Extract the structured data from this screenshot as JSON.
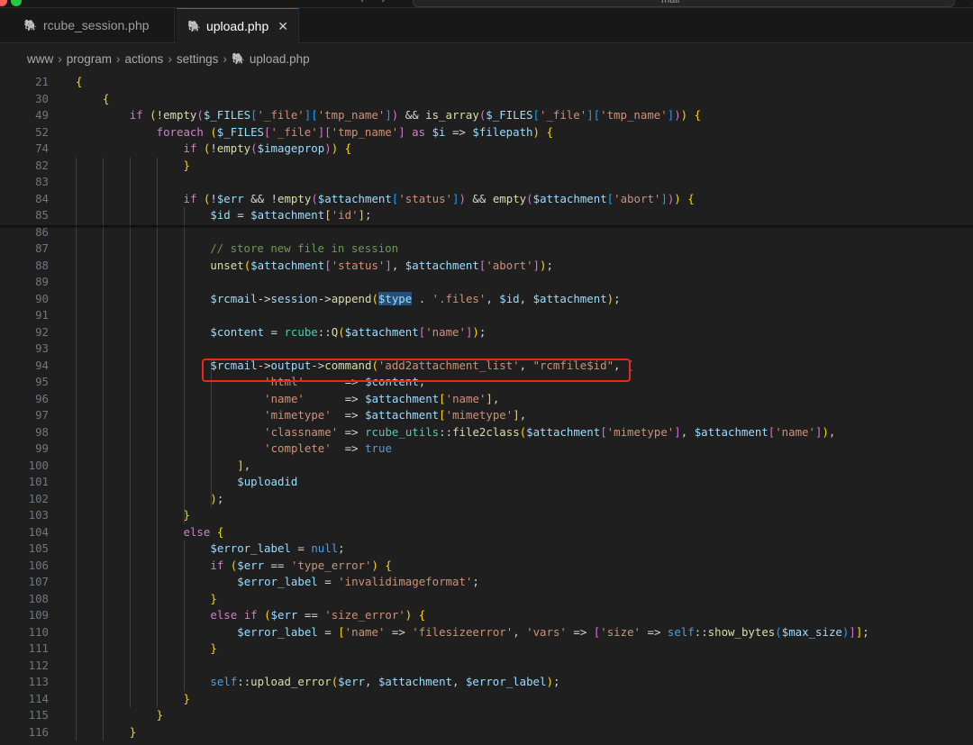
{
  "titlebar": {
    "nav": "‹ ›",
    "search_text": "mail"
  },
  "tabs": [
    {
      "label": "rcube_session.php",
      "active": false
    },
    {
      "label": "upload.php",
      "active": true
    }
  ],
  "breadcrumb": [
    "www",
    "program",
    "actions",
    "settings",
    "upload.php"
  ],
  "colors": {
    "keyword": "#c586c0",
    "function": "#dcdcaa",
    "variable": "#9cdcfe",
    "string": "#ce9178",
    "comment": "#6a9955",
    "highlight_box": "#e8281b"
  },
  "code_lines": [
    {
      "n": "21",
      "code": "{"
    },
    {
      "n": "30",
      "code": "    {"
    },
    {
      "n": "49",
      "code": "        if (!empty($_FILES['_file']['tmp_name']) && is_array($_FILES['_file']['tmp_name'])) {"
    },
    {
      "n": "52",
      "code": "            foreach ($_FILES['_file']['tmp_name'] as $i => $filepath) {"
    },
    {
      "n": "74",
      "code": "                if (!empty($imageprop)) {"
    },
    {
      "n": "82",
      "code": "                }"
    },
    {
      "n": "83",
      "code": ""
    },
    {
      "n": "84",
      "code": "                if (!$err && !empty($attachment['status']) && empty($attachment['abort'])) {"
    },
    {
      "n": "85",
      "code": "                    $id = $attachment['id'];"
    },
    {
      "n": "86",
      "code": ""
    },
    {
      "n": "87",
      "code": "                    // store new file in session"
    },
    {
      "n": "88",
      "code": "                    unset($attachment['status'], $attachment['abort']);"
    },
    {
      "n": "89",
      "code": ""
    },
    {
      "n": "90",
      "code": "                    $rcmail->session->append($type . '.files', $id, $attachment);"
    },
    {
      "n": "91",
      "code": ""
    },
    {
      "n": "92",
      "code": "                    $content = rcube::Q($attachment['name']);"
    },
    {
      "n": "93",
      "code": ""
    },
    {
      "n": "94",
      "code": "                    $rcmail->output->command('add2attachment_list', \"rcmfile$id\", ["
    },
    {
      "n": "95",
      "code": "                            'html'      => $content,"
    },
    {
      "n": "96",
      "code": "                            'name'      => $attachment['name'],"
    },
    {
      "n": "97",
      "code": "                            'mimetype'  => $attachment['mimetype'],"
    },
    {
      "n": "98",
      "code": "                            'classname' => rcube_utils::file2class($attachment['mimetype'], $attachment['name']),"
    },
    {
      "n": "99",
      "code": "                            'complete'  => true"
    },
    {
      "n": "100",
      "code": "                        ],"
    },
    {
      "n": "101",
      "code": "                        $uploadid"
    },
    {
      "n": "102",
      "code": "                    );"
    },
    {
      "n": "103",
      "code": "                }"
    },
    {
      "n": "104",
      "code": "                else {"
    },
    {
      "n": "105",
      "code": "                    $error_label = null;"
    },
    {
      "n": "106",
      "code": "                    if ($err == 'type_error') {"
    },
    {
      "n": "107",
      "code": "                        $error_label = 'invalidimageformat';"
    },
    {
      "n": "108",
      "code": "                    }"
    },
    {
      "n": "109",
      "code": "                    else if ($err == 'size_error') {"
    },
    {
      "n": "110",
      "code": "                        $error_label = ['name' => 'filesizeerror', 'vars' => ['size' => self::show_bytes($max_size)]];"
    },
    {
      "n": "111",
      "code": "                    }"
    },
    {
      "n": "112",
      "code": ""
    },
    {
      "n": "113",
      "code": "                    self::upload_error($err, $attachment, $error_label);"
    },
    {
      "n": "114",
      "code": "                }"
    },
    {
      "n": "115",
      "code": "            }"
    },
    {
      "n": "116",
      "code": "        }"
    }
  ]
}
